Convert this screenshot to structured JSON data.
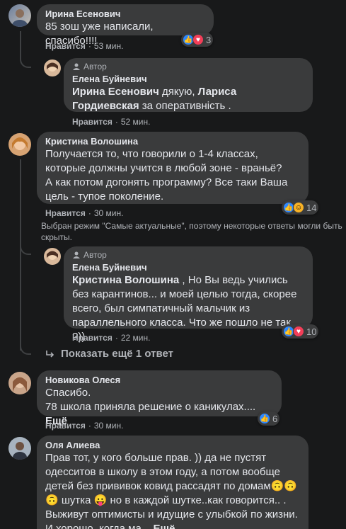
{
  "comments": [
    {
      "author": "Ирина Есенович",
      "text": "85 зош уже написали, спасибо!!!!",
      "like": "Нравится",
      "time": "53 мин.",
      "reactions_count": "3"
    },
    {
      "author_badge": "Автор",
      "author": "Елена Буйневич",
      "mention1": "Ирина Есенович",
      "text_mid": " дякую, ",
      "mention2": "Лариса Гордиевская",
      "text_end": " за оперативність .",
      "like": "Нравится",
      "time": "52 мин."
    },
    {
      "author": "Кристина Волошина",
      "text": "Получается то, что говорили о 1-4 классах, которые должны учится в любой зоне - враньё?\nА как потом догонять программу? Все таки Ваша цель - тупое поколение.",
      "like": "Нравится",
      "time": "30 мин.",
      "reactions_count": "14"
    },
    {
      "author_badge": "Автор",
      "author": "Елена Буйневич",
      "mention1": "Кристина Волошина",
      "text": " , Но Вы ведь учились без карантинов... и моей целью тогда, скорее всего, был симпатичный мальчик из параллельного класса. Что же пошло не так ?))",
      "like": "Нравится",
      "time": "22 мин.",
      "reactions_count": "10"
    },
    {
      "author": "Новикова Олеся",
      "text": "Спасибо.\n78 школа приняла решение о каникулах....",
      "more": "Ещё",
      "like": "Нравится",
      "time": "30 мин.",
      "reactions_count": "6"
    },
    {
      "author": "Оля Алиева",
      "text_a": "Прав тот, у кого больше прав. )) да не пустят одесситов в школу в этом году, а потом вообще детей без прививок ковид рассадят по домам",
      "text_b": " шутка ",
      "text_c": " но в каждой шутке..как говорится.. . Выживут оптимисты и идущие с улыбкой по жизни. И хорошо, когда ма...",
      "more": "Ещё"
    }
  ],
  "notice": "Выбран режим \"Самые актуальные\", поэтому некоторые ответы могли быть скрыты.",
  "show_more_replies": "Показать ещё 1 ответ",
  "colors": {
    "background": "#18191a",
    "bubble": "#3a3b3c",
    "text": "#e4e6eb",
    "secondary": "#b0b3b8",
    "like": "#2d88ff",
    "love": "#f33e58",
    "haha": "#f7b125"
  }
}
